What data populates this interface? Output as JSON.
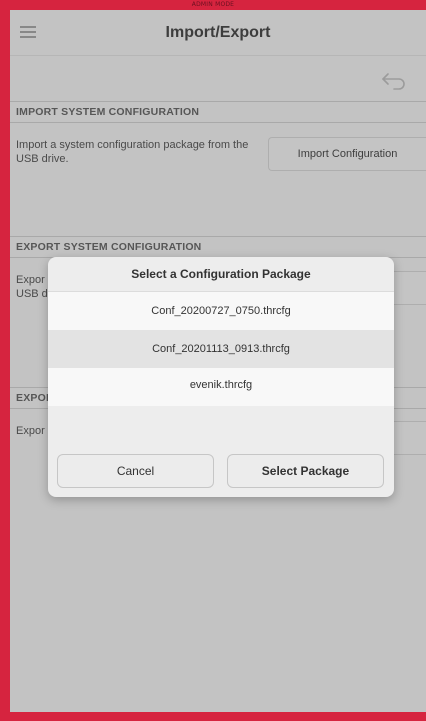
{
  "banner": "ADMIN MODE",
  "header": {
    "title": "Import/Export",
    "menu_icon": "hamburger-menu-icon",
    "back_icon": "back-arrow-icon"
  },
  "sections": {
    "import": {
      "heading": "IMPORT SYSTEM CONFIGURATION",
      "description": "Import a system configuration package from the USB drive.",
      "button": "Import Configuration"
    },
    "export_system": {
      "heading": "EXPORT SYSTEM CONFIGURATION",
      "description_visible_line1": "Expor",
      "description_visible_line2": "USB d"
    },
    "export_other": {
      "heading_visible": "EXPOI",
      "description_visible": "Expor"
    }
  },
  "dialog": {
    "title": "Select a Configuration Package",
    "packages": [
      "Conf_20200727_0750.thrcfg",
      "Conf_20201113_0913.thrcfg",
      "evenik.thrcfg"
    ],
    "selected_index": 1,
    "cancel_label": "Cancel",
    "select_label": "Select Package"
  },
  "colors": {
    "frame": "#d6243f",
    "background": "#ececec"
  }
}
